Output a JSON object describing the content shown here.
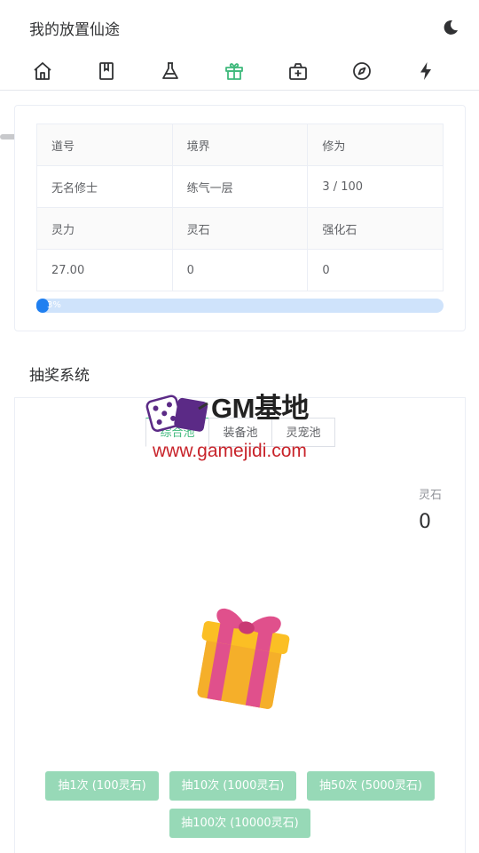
{
  "header": {
    "title": "我的放置仙途",
    "theme_icon": "moon-icon"
  },
  "nav": {
    "items": [
      {
        "icon": "home-icon"
      },
      {
        "icon": "book-icon"
      },
      {
        "icon": "flask-icon"
      },
      {
        "icon": "gift-icon",
        "active": true
      },
      {
        "icon": "medical-box-icon"
      },
      {
        "icon": "compass-icon"
      },
      {
        "icon": "lightning-icon"
      }
    ],
    "active_color": "#3fb97c"
  },
  "stats": {
    "headers_row1": [
      "道号",
      "境界",
      "修为"
    ],
    "values_row1": [
      "无名修士",
      "练气一层",
      "3 / 100"
    ],
    "headers_row2": [
      "灵力",
      "灵石",
      "强化石"
    ],
    "values_row2": [
      "27.00",
      "0",
      "0"
    ],
    "progress_label": "3%",
    "progress_value": 0.03
  },
  "lottery": {
    "title": "抽奖系统",
    "tabs": [
      "综合池",
      "装备池",
      "灵宠池"
    ],
    "active_tab": 0,
    "stone_label": "灵石",
    "stone_value": "0",
    "buttons": [
      "抽1次 (100灵石)",
      "抽10次 (1000灵石)",
      "抽50次 (5000灵石)",
      "抽100次 (10000灵石)"
    ]
  },
  "watermark": {
    "title": "GM基地",
    "url": "www.gamejidi.com"
  }
}
